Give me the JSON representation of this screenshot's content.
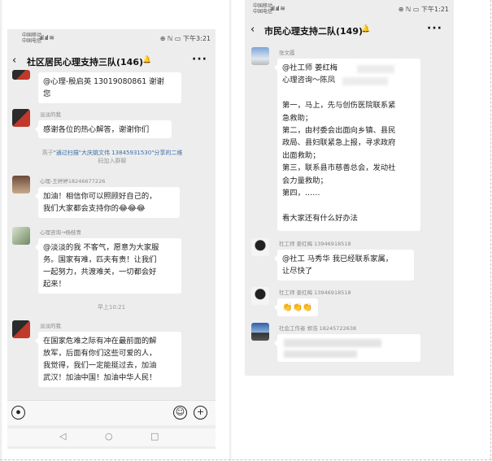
{
  "left_phone": {
    "status": {
      "carrier_line1": "中国移动",
      "carrier_line2": "中国电信",
      "signal": "ᵢııl ᵢııl ≋",
      "right": "⊕ ℕ ▭ 下午3:21"
    },
    "title": "社区居民心理支持三队(146)",
    "back_icon": "chevron-left-icon",
    "bell_icon": "mute-bell-icon",
    "more_label": "···",
    "messages": [
      {
        "sender": "",
        "lines": [
          "@心理-殷启英 13019080861 谢谢",
          "您"
        ],
        "phone": "13019080861"
      },
      {
        "sender": "淡淡的我",
        "lines": [
          "感谢各位的热心解答，谢谢你们"
        ]
      },
      {
        "sender": "心理-王婷婷18246677226",
        "lines": [
          "加油！相信你可以照顾好自己的，",
          "我们大家都会支持你的😂😂😂"
        ]
      },
      {
        "sender": "心理咨询→杨枝青",
        "lines": [
          "@淡淡的我  不客气，愿意为大家服",
          "务。国家有难，匹夫有责！让我们",
          "一起努力，共渡难关，一切都会好",
          "起来！"
        ]
      },
      {
        "sender": "淡淡的我",
        "lines": [
          "在国家危难之际有冲在最前面的解",
          "放军，后面有你们这些可爱的人，",
          "我觉得，我们一定能挺过去，加油",
          "武汉！加油中国！加油中华人民！"
        ]
      }
    ],
    "system_message": {
      "prefix": "燕子",
      "middle": "\"通过扫描\"大庆姚文伟 13845931530\"分享的二维",
      "suffix": "码加入群聊"
    },
    "timestamp": "早上10:21",
    "input": {
      "voice_icon": "voice-icon",
      "emoji_icon": "emoji-icon",
      "plus_icon": "plus-icon"
    },
    "nav": {
      "back": "◁",
      "home": "○",
      "recent": "□"
    }
  },
  "right_phone": {
    "status": {
      "carrier_line1": "中国移动",
      "carrier_line2": "中国电信",
      "signal": "ᵢııl ᵢııl ≋",
      "right": "⊕ ℕ ▭ 下午1:21"
    },
    "title": "市民心理支持二队(149)",
    "back_icon": "chevron-left-icon",
    "bell_icon": "mute-bell-icon",
    "more_label": "···",
    "messages": [
      {
        "sender": "张文霞",
        "lines": [
          "@社工师 姜红梅",
          "心理咨询～陈凤",
          "",
          "第一，马上，先与创伤医院联系紧",
          "急救助；",
          "第二，由村委会出面向乡镇、县民",
          "政局、县妇联紧急上报，寻求政府",
          "出面救助；",
          "第三，联系县市慈善总会，发动社",
          "会力量救助；",
          "第四，……",
          "",
          "看大家还有什么好办法"
        ]
      },
      {
        "sender": "社工师 姜红梅 13946918518",
        "lines": [
          "@社工 马秀华  我已经联系家属，",
          "让尽快了"
        ]
      },
      {
        "sender": "社工师 姜红梅 13946918518",
        "lines": [
          "👏👏👏"
        ]
      },
      {
        "sender": "社会工作者 郑浩 18245722638",
        "lines": [
          ""
        ]
      }
    ]
  }
}
